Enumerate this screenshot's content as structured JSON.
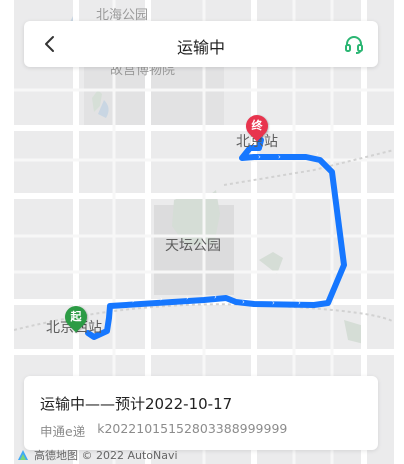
{
  "header": {
    "title": "运输中",
    "back_icon": "chevron-left-icon",
    "support_icon": "headset-icon",
    "accent_color": "#2bb673"
  },
  "map": {
    "labels": {
      "top": "北海公园",
      "museum": "故宫博物院",
      "end_station": "北京站",
      "park": "天坛公园",
      "start_station": "北京西站"
    },
    "start_marker": "起",
    "end_marker": "终",
    "route_color": "#1677ff",
    "start_color": "#2c9b45",
    "end_color": "#e8344e"
  },
  "card": {
    "status_line": "运输中——预计2022-10-17",
    "carrier": "申通e递",
    "tracking_number": "k20221015152803388999999"
  },
  "attribution": {
    "text": "高德地图 © 2022 AutoNavi"
  }
}
